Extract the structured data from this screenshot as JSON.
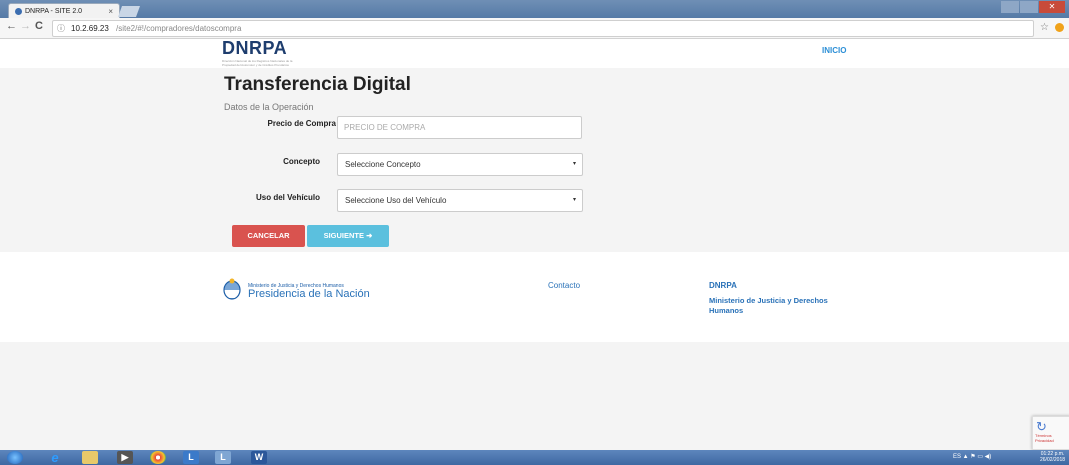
{
  "browser": {
    "tab_title": "DNRPA - SITE 2.0",
    "tab_close": "×",
    "back": "←",
    "forward": "→",
    "reload": "C",
    "info": "ⓘ",
    "url_host": "10.2.69.23",
    "url_path": "/site2/#!/compradores/datoscompra",
    "bookmark_star": "☆"
  },
  "header": {
    "logo": "DNRPA",
    "logo_subtitle": "Dirección Nacional de los Registros Nacionales de la Propiedad del Automotor y de Créditos Prendarios",
    "nav_inicio": "INICIO"
  },
  "form": {
    "title": "Transferencia Digital",
    "section_label": "Datos de la Operación",
    "precio_label": "Precio de Compra",
    "precio_placeholder": "PRECIO DE COMPRA",
    "concepto_label": "Concepto",
    "concepto_value": "Seleccione Concepto",
    "uso_label": "Uso del Vehículo",
    "uso_value": "Seleccione Uso del Vehículo",
    "caret": "▾",
    "cancel_label": "CANCELAR",
    "next_label": "SIGUIENTE ➜"
  },
  "footer": {
    "ministry_small": "Ministerio de Justicia y Derechos Humanos",
    "presidencia": "Presidencia de la Nación",
    "contacto": "Contacto",
    "dnrpa": "DNRPA",
    "ministerio": "Ministerio de Justicia y Derechos Humanos"
  },
  "captcha_text": "Términos Privacidad",
  "taskbar": {
    "tray": "ES  ▲  ⚑  ▭  ◀)",
    "time": "01:22 p.m.",
    "date": "26/02/2018"
  },
  "colors": {
    "cancel": "#d9534f",
    "next": "#5bc0de",
    "link": "#2a72b8",
    "logo": "#1e3d6e"
  }
}
